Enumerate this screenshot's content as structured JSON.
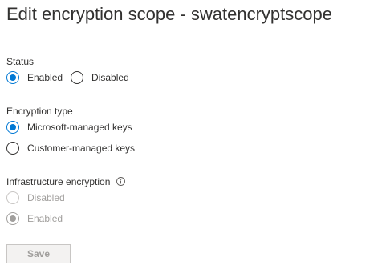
{
  "page": {
    "title": "Edit encryption scope - swatencryptscope"
  },
  "status": {
    "label": "Status",
    "options": [
      {
        "label": "Enabled",
        "checked": true
      },
      {
        "label": "Disabled",
        "checked": false
      }
    ]
  },
  "encryption_type": {
    "label": "Encryption type",
    "options": [
      {
        "label": "Microsoft-managed keys",
        "checked": true
      },
      {
        "label": "Customer-managed keys",
        "checked": false
      }
    ]
  },
  "infrastructure_encryption": {
    "label": "Infrastructure encryption",
    "info_icon": "info-icon",
    "disabled": true,
    "options": [
      {
        "label": "Disabled",
        "checked": false
      },
      {
        "label": "Enabled",
        "checked": true
      }
    ]
  },
  "actions": {
    "save_label": "Save",
    "save_disabled": true
  },
  "colors": {
    "accent": "#0078d4",
    "text": "#323130",
    "disabled_text": "#a19f9d",
    "disabled_border": "#c8c6c4"
  }
}
